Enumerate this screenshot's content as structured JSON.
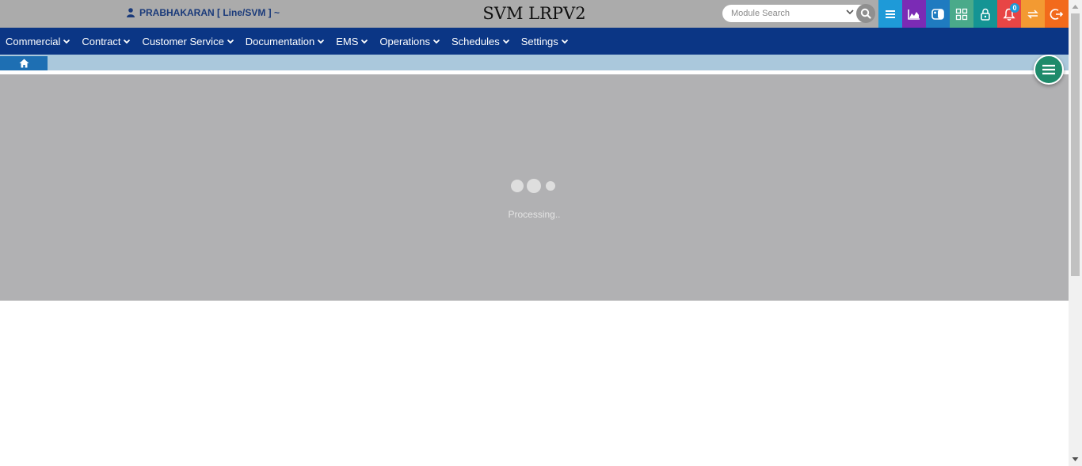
{
  "header": {
    "user_label": "PRABHAKARAN [ Line/SVM ] ~",
    "app_title": "SVM LRPV2",
    "search_placeholder": "Module Search",
    "notification_count": "0"
  },
  "toolbar": [
    {
      "icon": "menu-list-icon",
      "color": "#1e9ad8"
    },
    {
      "icon": "area-chart-icon",
      "color": "#7b2bb5"
    },
    {
      "icon": "switch-toggle-icon",
      "color": "#1f7bc0"
    },
    {
      "icon": "grid-apps-icon",
      "color": "#4aaa8a"
    },
    {
      "icon": "lock-icon",
      "color": "#149494"
    },
    {
      "icon": "bell-icon",
      "color": "#e84545"
    },
    {
      "icon": "swap-arrows-icon",
      "color": "#f39a32"
    },
    {
      "icon": "logout-icon",
      "color": "#f26a1b"
    }
  ],
  "nav": {
    "items": [
      {
        "label": "Commercial"
      },
      {
        "label": "Contract"
      },
      {
        "label": "Customer Service"
      },
      {
        "label": "Documentation"
      },
      {
        "label": "EMS"
      },
      {
        "label": "Operations"
      },
      {
        "label": "Schedules"
      },
      {
        "label": "Settings"
      }
    ]
  },
  "loader": {
    "text": "Processing.."
  },
  "colors": {
    "header_bg": "#ababab",
    "nav_bg": "#0b3685",
    "breadcrumb_bg": "#aac8dc",
    "home_tab": "#1e6fb3",
    "overlay_bg": "#b1b1b3",
    "fab_bg": "#1e8a6a"
  }
}
